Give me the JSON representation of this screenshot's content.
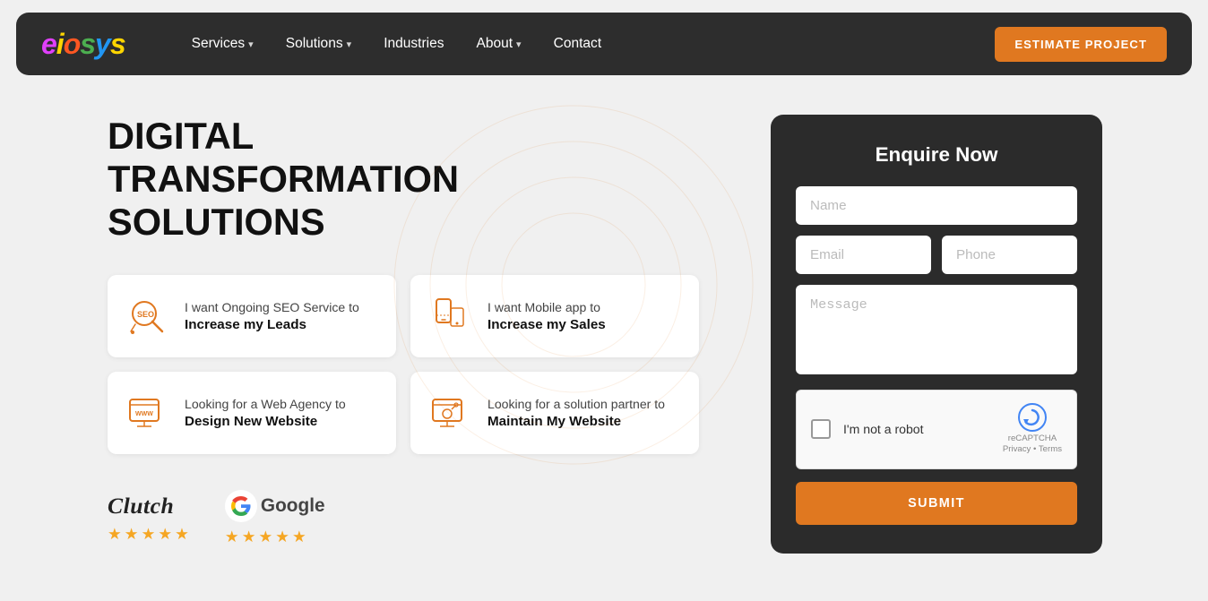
{
  "navbar": {
    "logo": "eiosys",
    "nav_items": [
      {
        "label": "Services",
        "has_dropdown": true
      },
      {
        "label": "Solutions",
        "has_dropdown": true
      },
      {
        "label": "Industries",
        "has_dropdown": false
      },
      {
        "label": "About",
        "has_dropdown": true
      },
      {
        "label": "Contact",
        "has_dropdown": false
      }
    ],
    "cta_label": "ESTIMATE PROJECT"
  },
  "hero": {
    "title_line1": "DIGITAL TRANSFORMATION",
    "title_line2": "SOLUTIONS"
  },
  "service_cards": [
    {
      "id": "seo",
      "top_text": "I want Ongoing SEO Service to",
      "bold_text": "Increase my Leads"
    },
    {
      "id": "mobile",
      "top_text": "I want Mobile app to",
      "bold_text": "Increase my Sales"
    },
    {
      "id": "web",
      "top_text": "Looking for a Web Agency to",
      "bold_text": "Design New Website"
    },
    {
      "id": "maintain",
      "top_text": "Looking for a solution partner to",
      "bold_text": "Maintain My Website"
    }
  ],
  "ratings": [
    {
      "name": "Clutch",
      "stars": 5
    },
    {
      "name": "Google",
      "stars": 5
    }
  ],
  "form": {
    "title": "Enquire Now",
    "name_placeholder": "Name",
    "email_placeholder": "Email",
    "phone_placeholder": "Phone",
    "message_placeholder": "Message",
    "recaptcha_label": "I'm not a robot",
    "recaptcha_subtext1": "reCAPTCHA",
    "recaptcha_subtext2": "Privacy  •  Terms",
    "submit_label": "SUBMIT"
  }
}
